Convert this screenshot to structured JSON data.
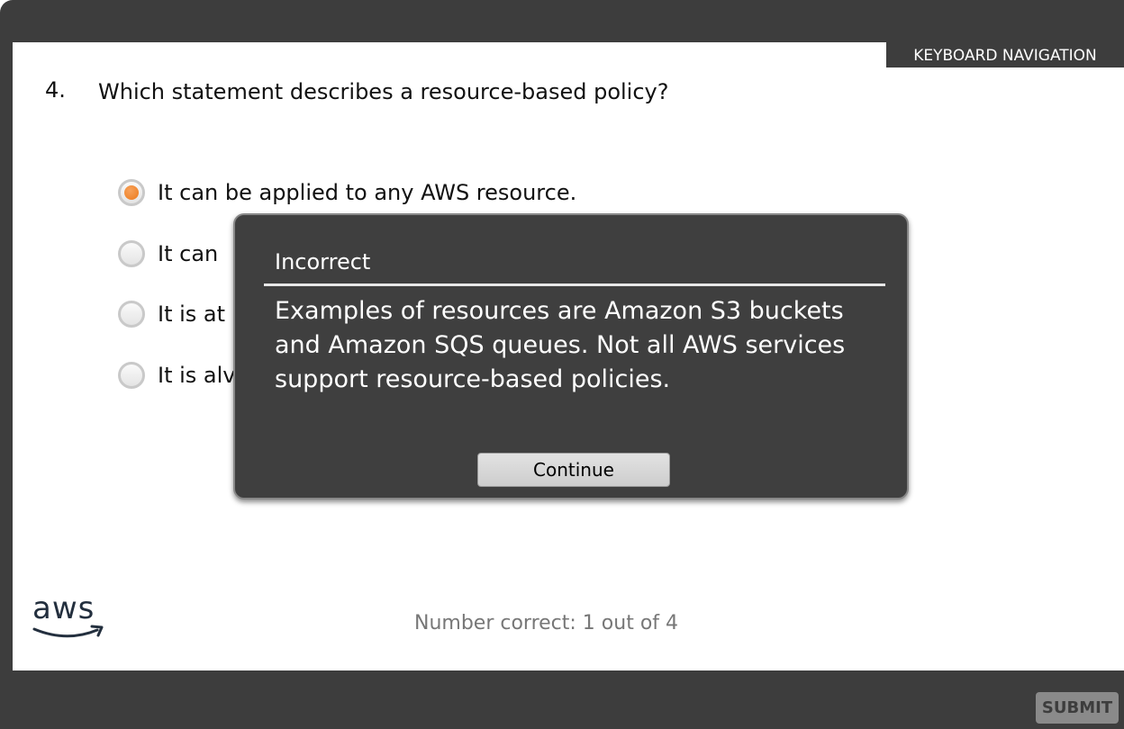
{
  "header": {
    "keyboard_navigation_label": "KEYBOARD NAVIGATION"
  },
  "question": {
    "number": "4.",
    "text": "Which statement describes a resource-based policy?"
  },
  "options": [
    {
      "label": "It can be applied to any AWS resource.",
      "selected": true
    },
    {
      "label": "It can",
      "selected": false
    },
    {
      "label": "It is at",
      "selected": false
    },
    {
      "label": "It is alv",
      "selected": false
    }
  ],
  "feedback_dialog": {
    "title": "Incorrect",
    "body": "Examples of resources are Amazon S3 buckets and Amazon SQS queues. Not all AWS services support resource-based policies.",
    "continue_label": "Continue"
  },
  "footer": {
    "logo_text": "aws",
    "score_text": "Number correct: 1 out of 4",
    "submit_label": "SUBMIT"
  },
  "colors": {
    "frame": "#3d3d3d",
    "accent_orange": "#ec7a1c",
    "dialog_bg": "#3f3f3f"
  }
}
